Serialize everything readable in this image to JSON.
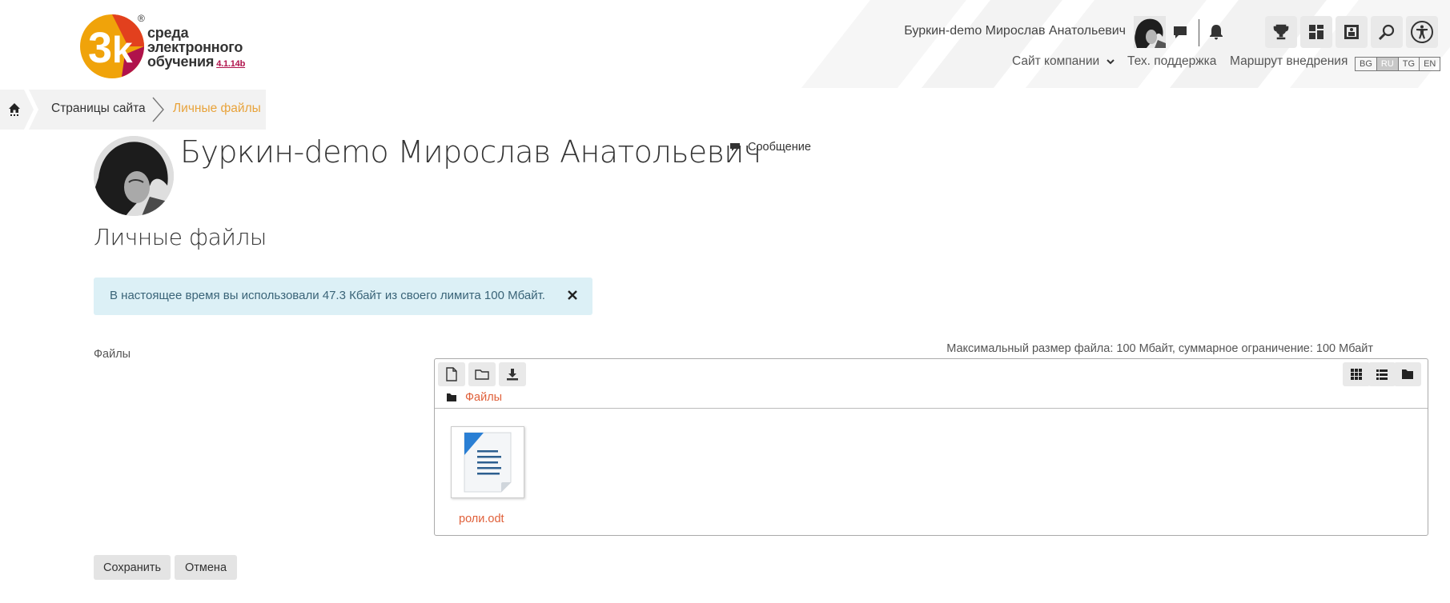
{
  "brand": {
    "logo_mark": "3k",
    "logo_reg": "®",
    "logo_line1": "среда",
    "logo_line2": "электронного",
    "logo_line3": "обучения",
    "version": "4.1.14b",
    "colors": {
      "orange": "#f0a30a",
      "red": "#e2401e",
      "crimson": "#b0124b"
    }
  },
  "header": {
    "user_name": "Буркин-demo Мирослав Анатольевич",
    "icons": [
      "comment-icon",
      "bell-icon",
      "trophy-icon",
      "dashboard-icon",
      "courses-icon",
      "search-icon",
      "accessibility-icon"
    ],
    "nav": {
      "company_site": "Сайт компании",
      "support": "Тех. поддержка",
      "roadmap": "Маршрут внедрения"
    },
    "languages": [
      "BG",
      "RU",
      "TG",
      "EN"
    ],
    "active_language": "RU"
  },
  "breadcrumb": {
    "pages": "Страницы сайта",
    "current": "Личные файлы"
  },
  "profile": {
    "name": "Буркин-demo Мирослав Анатольевич",
    "message_label": "Сообщение"
  },
  "page": {
    "heading": "Личные файлы",
    "alert_text": "В настоящее время вы использовали 47.3 Кбайт из своего лимита 100 Мбайт."
  },
  "files": {
    "label": "Файлы",
    "limit_text": "Максимальный размер файла: 100 Мбайт, суммарное ограничение: 100 Мбайт",
    "path_label": "Файлы",
    "items": [
      {
        "name": "роли.odt"
      }
    ]
  },
  "actions": {
    "save": "Сохранить",
    "cancel": "Отмена"
  }
}
